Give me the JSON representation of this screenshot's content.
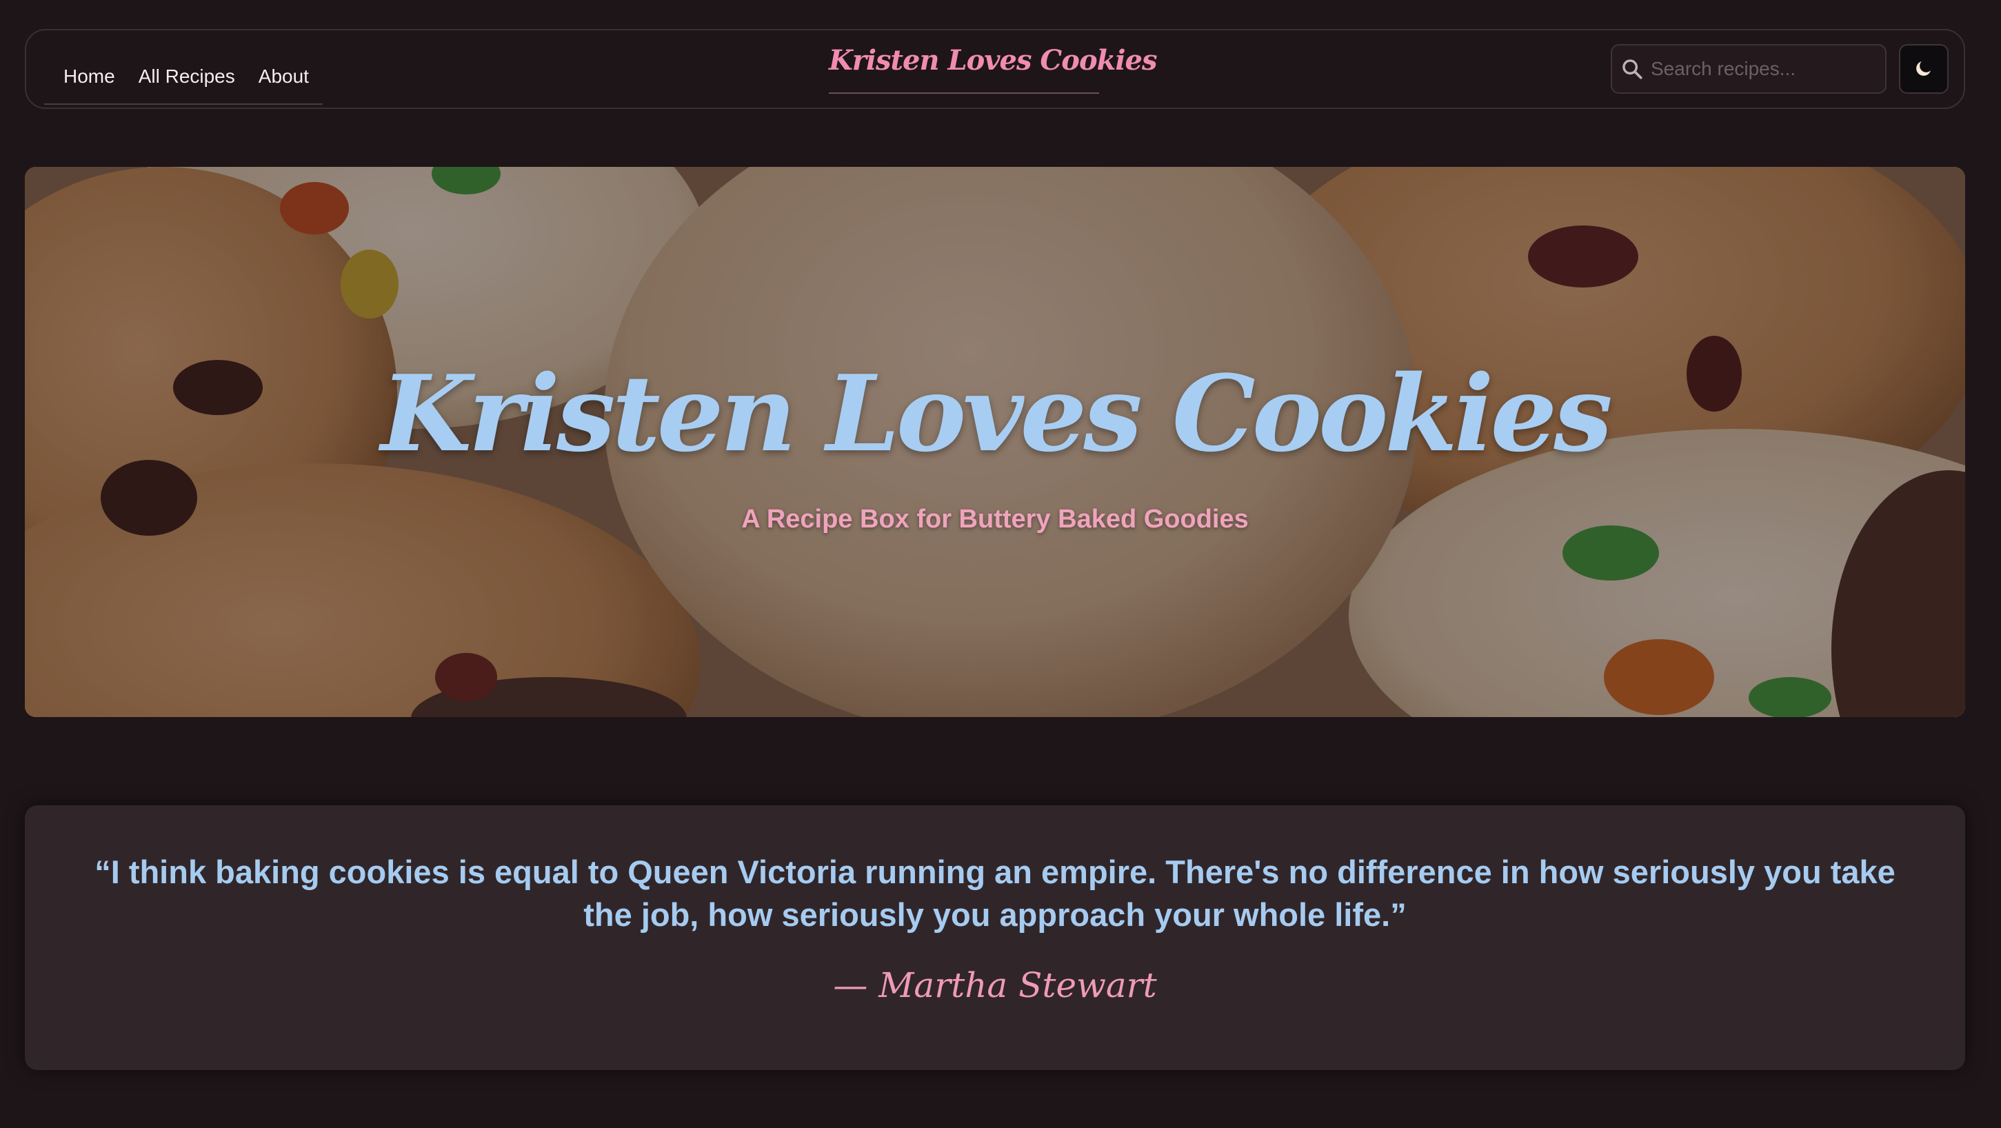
{
  "nav": {
    "links": [
      "Home",
      "All Recipes",
      "About"
    ],
    "brand": "Kristen Loves Cookies",
    "search_placeholder": "Search recipes...",
    "search_icon": "search-icon",
    "theme_toggle_icon": "moon-icon"
  },
  "hero": {
    "title": "Kristen Loves Cookies",
    "subtitle": "A Recipe Box for Buttery Baked Goodies",
    "background": "cookies-photo"
  },
  "quote": {
    "text": "“I think baking cookies is equal to Queen Victoria running an empire. There's no difference in how seriously you take the job, how seriously you approach your whole life.”",
    "author": "— Martha Stewart"
  },
  "colors": {
    "page_background": "#1e1518",
    "accent_pink": "#f08cb0",
    "accent_blue": "#a8cdf2",
    "card_background": "#30262a"
  }
}
